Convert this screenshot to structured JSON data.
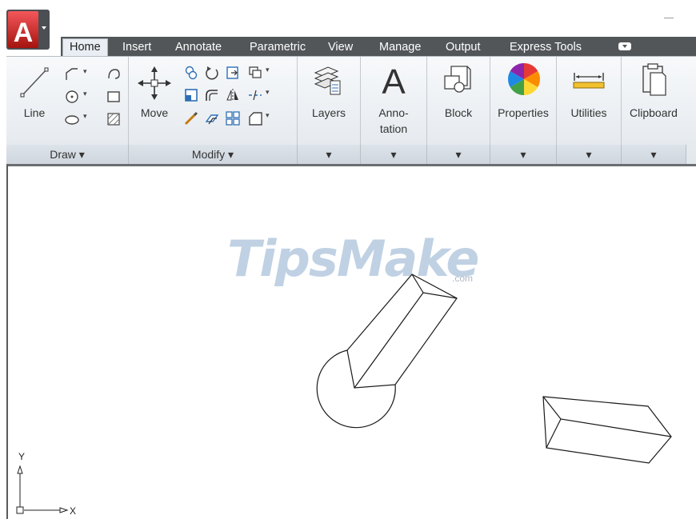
{
  "tabs": [
    {
      "label": "Home",
      "active": true
    },
    {
      "label": "Insert"
    },
    {
      "label": "Annotate"
    },
    {
      "label": "Parametric"
    },
    {
      "label": "View"
    },
    {
      "label": "Manage"
    },
    {
      "label": "Output"
    },
    {
      "label": "Express Tools"
    }
  ],
  "panels": {
    "draw": {
      "title": "Draw ▾",
      "line_label": "Line"
    },
    "modify": {
      "title": "Modify ▾",
      "move_label": "Move"
    },
    "layers": {
      "label": "Layers"
    },
    "annotation": {
      "label_line1": "Anno-",
      "label_line2": "tation"
    },
    "block": {
      "label": "Block"
    },
    "properties": {
      "label": "Properties"
    },
    "utilities": {
      "label": "Utilities"
    },
    "clipboard": {
      "label": "Clipboard"
    }
  },
  "canvas": {
    "watermark_text": "TipsMake",
    "watermark_suffix": ".com",
    "ucs_x_label": "X",
    "ucs_y_label": "Y"
  },
  "colors": {
    "tab_bar": "#525659",
    "ribbon": "#e9eef4",
    "app_logo": "#c8211e"
  },
  "icons": [
    "autocad-logo-icon",
    "line-icon",
    "polyline-icon",
    "circle-icon",
    "arc-icon",
    "rectangle-icon",
    "hatch-icon",
    "move-icon",
    "rotate-icon",
    "copy-icon",
    "mirror-icon",
    "fillet-icon",
    "stretch-icon",
    "scale-icon",
    "array-icon",
    "trim-icon",
    "layers-icon",
    "text-icon",
    "block-icon",
    "properties-icon",
    "measure-icon",
    "clipboard-icon"
  ]
}
